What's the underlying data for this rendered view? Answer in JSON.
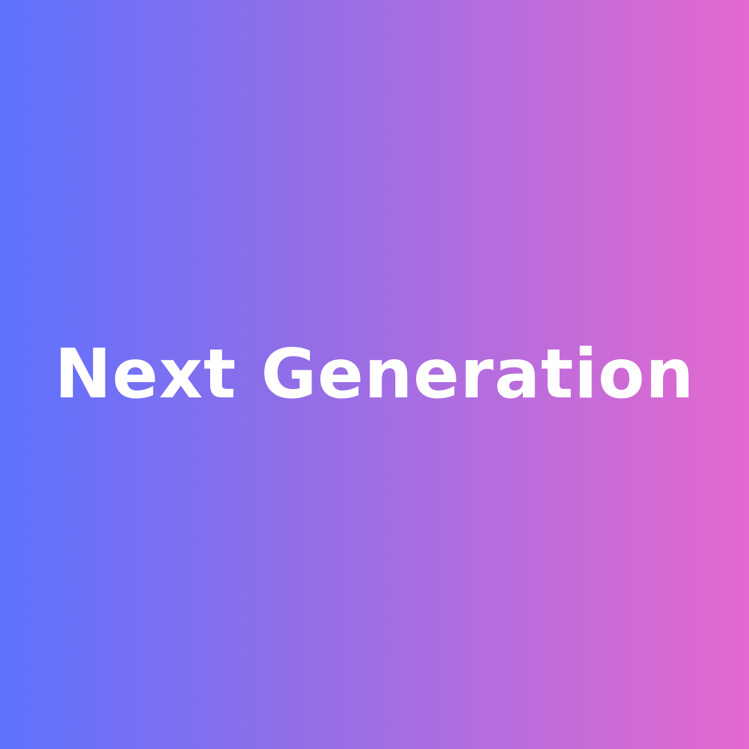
{
  "headline": "Next Generation",
  "colors": {
    "gradient_start": "#5e72ff",
    "gradient_mid_1": "#8f6ee8",
    "gradient_mid_2": "#b06ddf",
    "gradient_end": "#e468cf",
    "text": "#ffffff"
  }
}
